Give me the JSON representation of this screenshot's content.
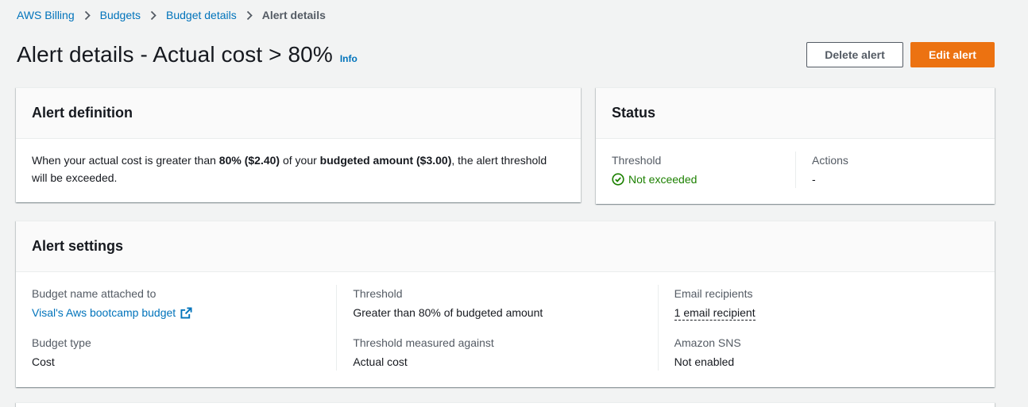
{
  "breadcrumb": {
    "items": [
      "AWS Billing",
      "Budgets",
      "Budget details"
    ],
    "current": "Alert details"
  },
  "header": {
    "title": "Alert details - Actual cost > 80%",
    "info": "Info",
    "delete_label": "Delete alert",
    "edit_label": "Edit alert"
  },
  "definition": {
    "title": "Alert definition",
    "text_1": "When your actual cost is greater than ",
    "bold_1": "80% ($2.40)",
    "text_2": " of your ",
    "bold_2": "budgeted amount ($3.00)",
    "text_3": ", the alert threshold will be exceeded."
  },
  "status": {
    "title": "Status",
    "threshold_label": "Threshold",
    "threshold_value": "Not exceeded",
    "threshold_icon": "check-circle-icon",
    "actions_label": "Actions",
    "actions_value": "-"
  },
  "settings": {
    "title": "Alert settings",
    "budget_name_label": "Budget name attached to",
    "budget_name_value": "Visal's Aws bootcamp budget",
    "budget_type_label": "Budget type",
    "budget_type_value": "Cost",
    "threshold_label": "Threshold",
    "threshold_value": "Greater than 80% of budgeted amount",
    "measured_label": "Threshold measured against",
    "measured_value": "Actual cost",
    "email_label": "Email recipients",
    "email_value": "1 email recipient",
    "sns_label": "Amazon SNS",
    "sns_value": "Not enabled"
  },
  "colors": {
    "link": "#0073bb",
    "primary": "#ec7211",
    "success": "#1d8102",
    "background": "#f2f3f3"
  }
}
